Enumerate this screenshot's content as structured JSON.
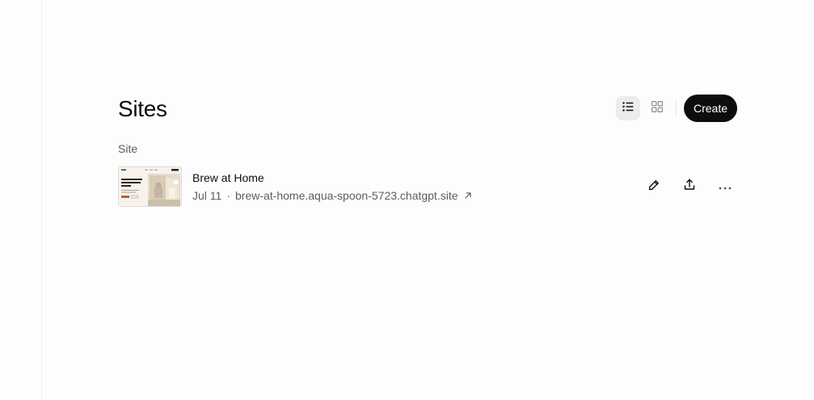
{
  "page": {
    "title": "Sites"
  },
  "toolbar": {
    "view_list_icon": "list-icon",
    "view_grid_icon": "grid-icon",
    "active_view": "list",
    "create_label": "Create"
  },
  "section": {
    "label": "Site"
  },
  "sites": [
    {
      "name": "Brew at Home",
      "date": "Jul 11",
      "separator": "·",
      "url": "brew-at-home.aqua-spoon-5723.chatgpt.site",
      "actions": [
        "edit-pencil-icon",
        "share-upload-icon",
        "more-options-icon"
      ]
    }
  ],
  "colors": {
    "background": "#fdfdfd",
    "primary_button": "#0d0d0d",
    "muted_text": "#5d5d5d",
    "active_toggle_bg": "#ececec"
  }
}
